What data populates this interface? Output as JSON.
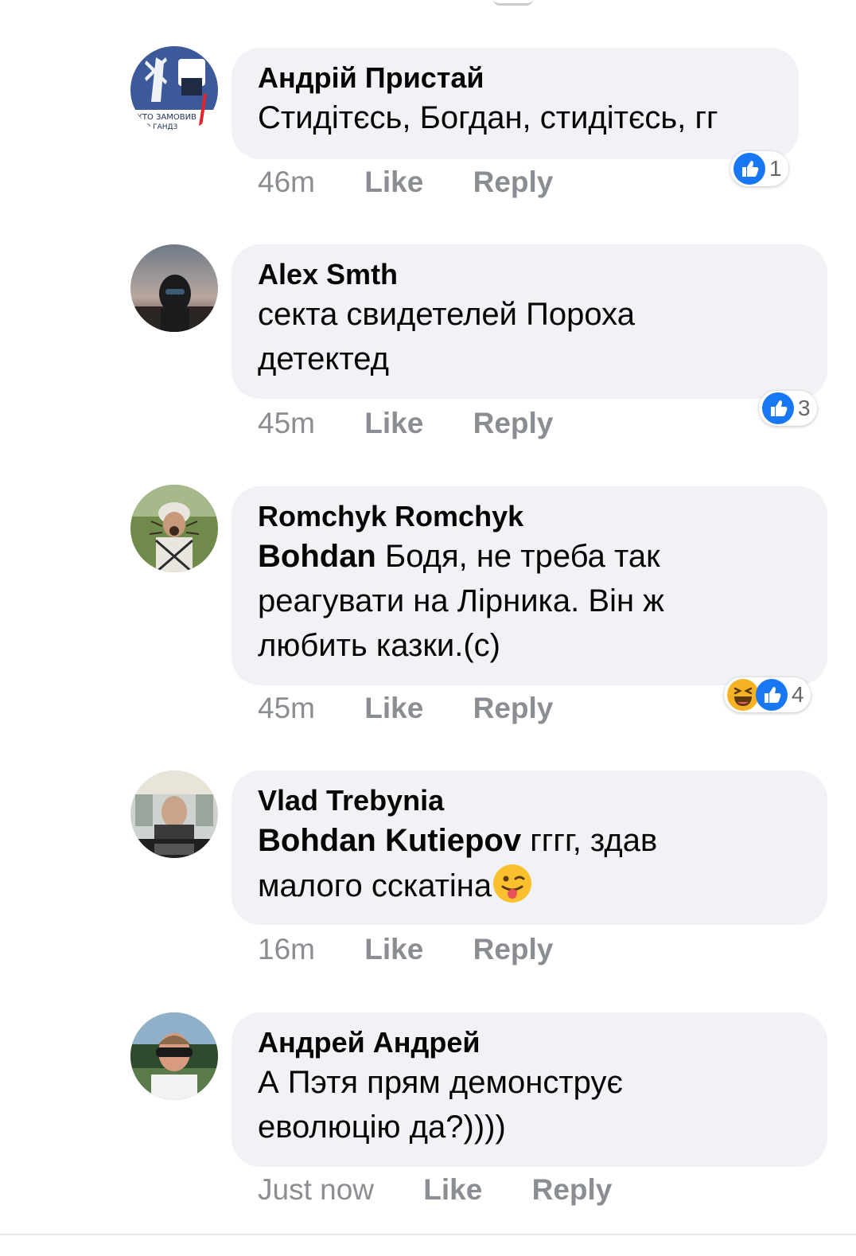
{
  "comments": [
    {
      "author": "Андрій Пристай",
      "mention": "",
      "text": "Стидітєсь, Богдан, стидітєсь, гг",
      "time": "46m",
      "like_label": "Like",
      "reply_label": "Reply",
      "reaction_count": "1",
      "reactions": [
        "like-icon"
      ],
      "avatar_text": "ХТО ЗАМОВИВ ... ТЮ ГАНДЗ..."
    },
    {
      "author": "Alex Smth",
      "mention": "",
      "text": "секта свидетелей Пороха детектед",
      "time": "45m",
      "like_label": "Like",
      "reply_label": "Reply",
      "reaction_count": "3",
      "reactions": [
        "like-icon"
      ]
    },
    {
      "author": "Romchyk Romchyk",
      "mention": "Bohdan",
      "text": "Бодя, не треба так реагувати на Лірника. Він ж любить казки.(с)",
      "time": "45m",
      "like_label": "Like",
      "reply_label": "Reply",
      "reaction_count": "4",
      "reactions": [
        "haha-icon",
        "like-icon"
      ]
    },
    {
      "author": "Vlad Trebynia",
      "mention": "Bohdan Kutiepov",
      "text": "гггг, здав малого сскатіна",
      "emoji": "winking-tongue-emoji",
      "time": "16m",
      "like_label": "Like",
      "reply_label": "Reply"
    },
    {
      "author": "Андрей Андрей",
      "mention": "",
      "text": "А Пэтя прям демонструє еволюцію да?))))",
      "time": "Just now",
      "like_label": "Like",
      "reply_label": "Reply"
    }
  ],
  "colors": {
    "bubble": "#f0f2f5",
    "meta_text": "#8a8d91",
    "like_blue": "#1877f2",
    "haha_yellow": "#f7b125"
  }
}
